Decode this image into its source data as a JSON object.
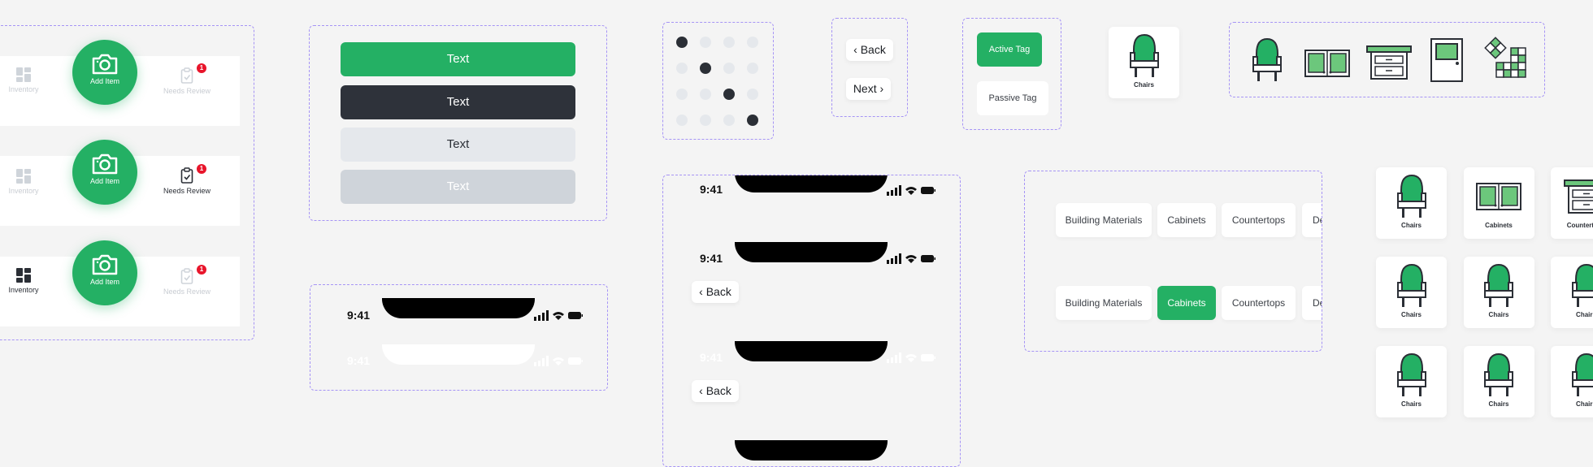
{
  "colors": {
    "brand_green": "#24b064",
    "dark": "#2b2f36",
    "badge_red": "#e8152b",
    "frame_dash": "#a694f5",
    "light_gray": "#e5e8ec",
    "mid_gray": "#cfd4da"
  },
  "nav_variants": [
    {
      "inventory_label": "Inventory",
      "add_label": "Add Item",
      "review_label": "Needs Review",
      "badge": "1",
      "active": "none"
    },
    {
      "inventory_label": "Inventory",
      "add_label": "Add Item",
      "review_label": "Needs Review",
      "badge": "1",
      "active": "review"
    },
    {
      "inventory_label": "Inventory",
      "add_label": "Add Item",
      "review_label": "Needs Review",
      "badge": "1",
      "active": "inventory"
    }
  ],
  "buttons": [
    {
      "label": "Text",
      "variant": "primary"
    },
    {
      "label": "Text",
      "variant": "dark"
    },
    {
      "label": "Text",
      "variant": "light"
    },
    {
      "label": "Text",
      "variant": "disabled"
    }
  ],
  "status_bar": {
    "time": "9:41"
  },
  "dot_grid": {
    "rows": 4,
    "cols": 4,
    "active": [
      [
        0,
        0
      ],
      [
        1,
        1
      ],
      [
        2,
        2
      ],
      [
        3,
        3
      ]
    ]
  },
  "nav_pills": {
    "back": "Back",
    "next": "Next"
  },
  "tags": {
    "active": "Active Tag",
    "passive": "Passive Tag"
  },
  "single_card": {
    "label": "Chairs",
    "icon": "chair-icon"
  },
  "icon_set": [
    "chair-icon",
    "cabinet-icon",
    "countertop-icon",
    "door-icon",
    "tile-icon"
  ],
  "phone_frames": {
    "back_label": "Back"
  },
  "chip_rows": [
    {
      "chips": [
        "Building Materials",
        "Cabinets",
        "Countertops",
        "De"
      ],
      "active_index": -1
    },
    {
      "chips": [
        "Building Materials",
        "Cabinets",
        "Countertops",
        "De"
      ],
      "active_index": 1
    }
  ],
  "card_grid": [
    [
      "Chairs",
      "Cabinets",
      "Countertops"
    ],
    [
      "Chairs",
      "Chairs",
      "Chairs"
    ],
    [
      "Chairs",
      "Chairs",
      "Chairs"
    ]
  ]
}
